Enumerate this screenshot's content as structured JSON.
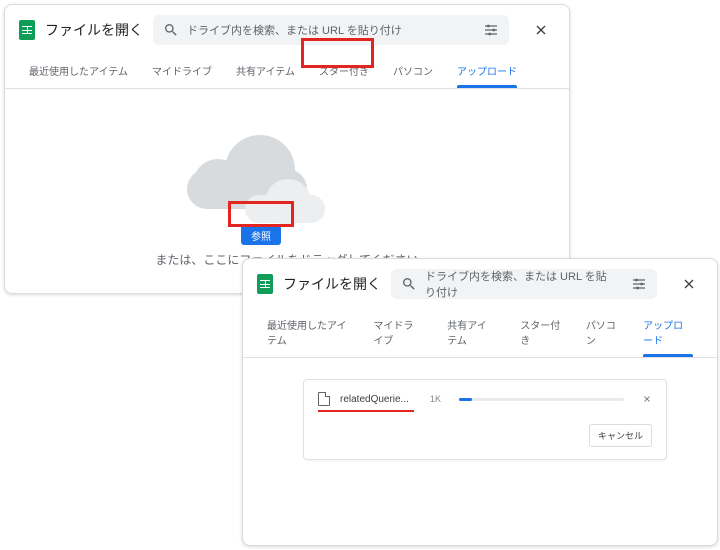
{
  "dialog1": {
    "title": "ファイルを開く",
    "search_placeholder": "ドライブ内を検索、または URL を貼り付け",
    "tabs": [
      "最近使用したアイテム",
      "マイドライブ",
      "共有アイテム",
      "スター付き",
      "パソコン",
      "アップロード"
    ],
    "active_tab_index": 5,
    "browse_label": "参照",
    "drag_text": "または、ここにファイルをドラッグしてください"
  },
  "dialog2": {
    "title": "ファイルを開く",
    "search_placeholder": "ドライブ内を検索、または URL を貼り付け",
    "tabs": [
      "最近使用したアイテム",
      "マイドライブ",
      "共有アイテム",
      "スター付き",
      "パソコン",
      "アップロード"
    ],
    "active_tab_index": 5,
    "upload": {
      "file_name": "relatedQuerie...",
      "file_size": "1K",
      "cancel_label": "キャンセル"
    }
  },
  "colors": {
    "accent": "#1a73e8",
    "highlight": "#e2261f",
    "sheets": "#0f9d58"
  }
}
